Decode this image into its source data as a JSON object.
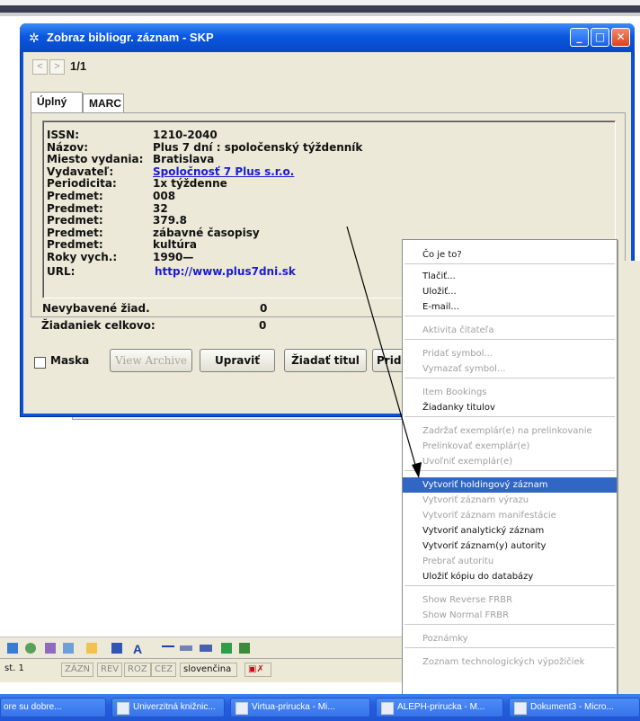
{
  "window": {
    "title": "Zobraz bibliogr. záznam - SKP",
    "record_counter": "1/1",
    "tabs": [
      "Úplný",
      "MARC"
    ]
  },
  "record": {
    "fields": [
      {
        "label": "ISSN:",
        "value": "1210-2040"
      },
      {
        "label": "Názov:",
        "value": "Plus 7 dní : spoločenský týždenník"
      },
      {
        "label": "Miesto vydania:",
        "value": "Bratislava"
      },
      {
        "label": "Vydavateľ:",
        "value": "Spoločnosť 7 Plus s.r.o."
      },
      {
        "label": "Periodicita:",
        "value": "1x týždenne"
      },
      {
        "label": "Predmet:",
        "value": "008"
      },
      {
        "label": "Predmet:",
        "value": "32"
      },
      {
        "label": "Predmet:",
        "value": "379.8"
      },
      {
        "label": "Predmet:",
        "value": "zábavné časopisy"
      },
      {
        "label": "Predmet:",
        "value": "kultúra"
      },
      {
        "label": "Roky vych.:",
        "value": "1990—"
      },
      {
        "label": "URL:",
        "value": "http://www.plus7dni.sk"
      }
    ],
    "stats": [
      {
        "label": "Nevybavené žiad.",
        "value": "0"
      },
      {
        "label": "Žiadaniek celkovo:",
        "value": "0"
      }
    ]
  },
  "buttons": {
    "mask": "Maska",
    "view_archive": "View Archive",
    "edit": "Upraviť",
    "request_title": "Žiadať titul",
    "add": "Prida"
  },
  "context_menu": [
    {
      "label": "Čo je to?",
      "state": "enabled"
    },
    {
      "label": "Tlačiť...",
      "state": "enabled"
    },
    {
      "label": "Uložiť...",
      "state": "enabled"
    },
    {
      "label": "E-mail...",
      "state": "enabled"
    },
    {
      "label": "Aktivita čitateľa",
      "state": "disabled"
    },
    {
      "label": "Pridať symbol...",
      "state": "disabled"
    },
    {
      "label": "Vymazať symbol...",
      "state": "disabled"
    },
    {
      "label": "Item Bookings",
      "state": "disabled"
    },
    {
      "label": "Žiadanky titulov",
      "state": "enabled"
    },
    {
      "label": "Zadržať exemplár(e) na prelinkovanie",
      "state": "disabled"
    },
    {
      "label": "Prelinkovať exemplár(e)",
      "state": "disabled"
    },
    {
      "label": "Uvoľniť exemplár(e)",
      "state": "disabled"
    },
    {
      "label": "Vytvoriť holdingový záznam",
      "state": "selected"
    },
    {
      "label": "Vytvoriť záznam výrazu",
      "state": "disabled"
    },
    {
      "label": "Vytvoriť záznam manifestácie",
      "state": "disabled"
    },
    {
      "label": "Vytvoriť analytický záznam",
      "state": "enabled"
    },
    {
      "label": "Vytvoriť záznam(y) autority",
      "state": "enabled"
    },
    {
      "label": "Prebrať autoritu",
      "state": "disabled"
    },
    {
      "label": "Uložiť kópiu do databázy",
      "state": "enabled"
    },
    {
      "label": "Show Reverse FRBR",
      "state": "disabled"
    },
    {
      "label": "Show Normal FRBR",
      "state": "disabled"
    },
    {
      "label": "Poznámky",
      "state": "disabled"
    },
    {
      "label": "Zoznam technologických výpožičiek",
      "state": "disabled"
    }
  ],
  "statusbar": {
    "page": "st. 1",
    "cells": [
      "ZÁZN",
      "REV",
      "ROZ",
      "CEZ"
    ],
    "language": "slovenčina"
  },
  "taskbar": [
    "ore su dobre...",
    "Univerzitná knižnic...",
    "Virtua-prirucka - Mi...",
    "ALEPH-prirucka - M...",
    "Dokument3 - Micro..."
  ]
}
